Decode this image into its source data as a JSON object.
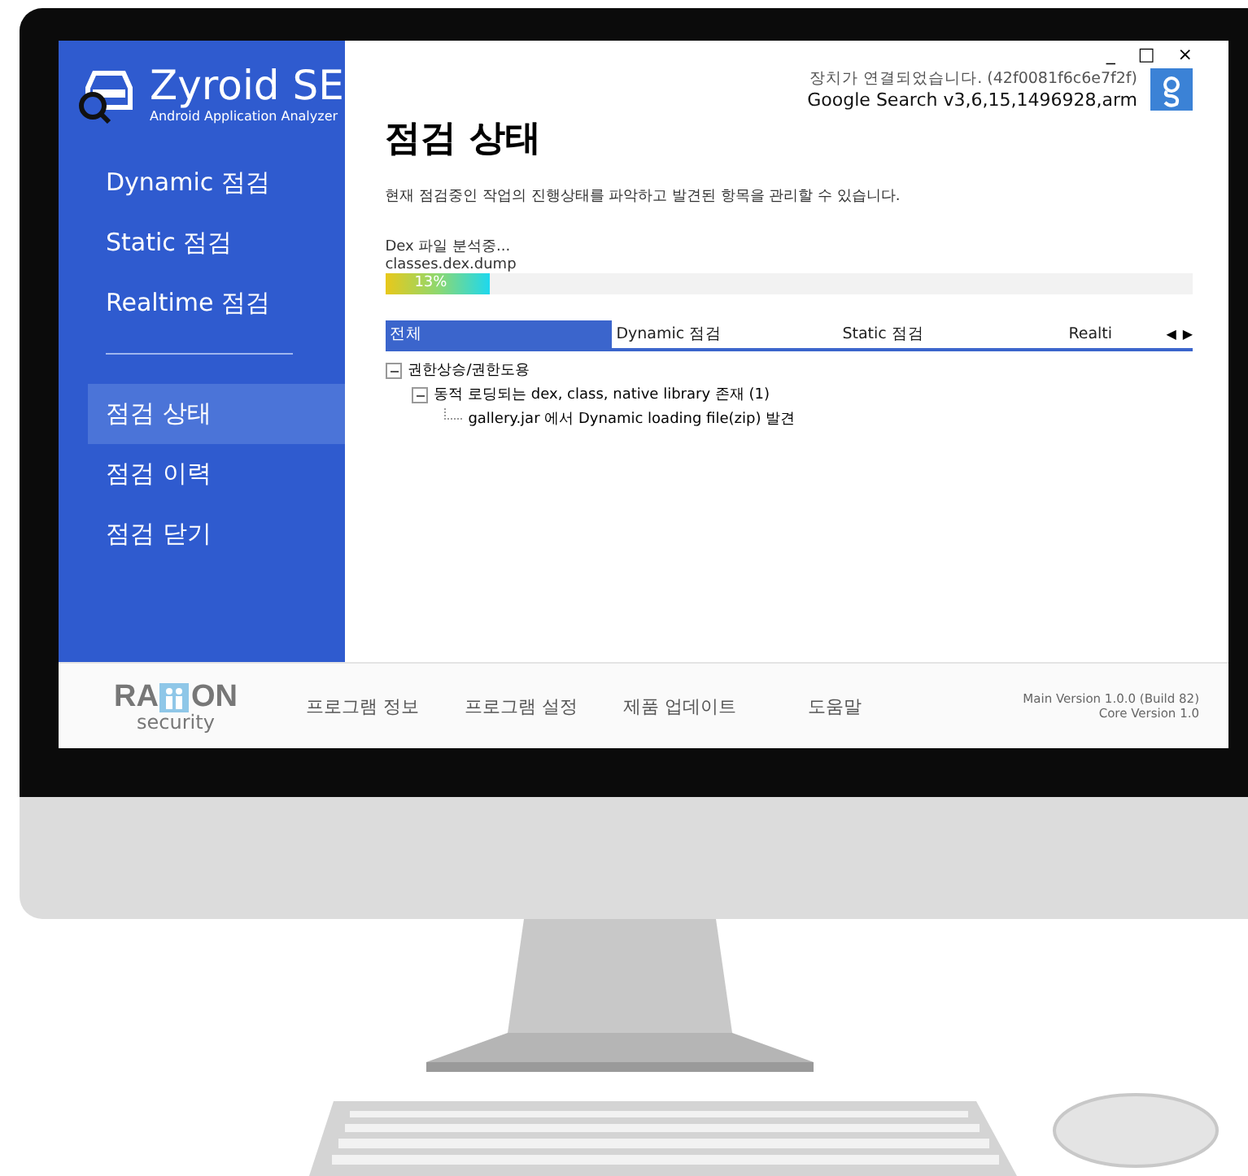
{
  "app": {
    "name": "Zyroid SE",
    "subtitle": "Android Application Analyzer"
  },
  "sidebar": {
    "items": [
      {
        "label": "Dynamic 점검",
        "selected": false
      },
      {
        "label": "Static 점검",
        "selected": false
      },
      {
        "label": "Realtime 점검",
        "selected": false
      }
    ],
    "items_2": [
      {
        "label": "점검 상태",
        "selected": true
      },
      {
        "label": "점검 이력",
        "selected": false
      },
      {
        "label": "점검 닫기",
        "selected": false
      }
    ]
  },
  "window_controls": [
    "_",
    "□",
    "×"
  ],
  "device": {
    "status": "장치가 연결되었습니다. (42f0081f6c6e7f2f)",
    "app": "Google Search v3,6,15,1496928,arm"
  },
  "page": {
    "title": "점검 상태",
    "description": "현재 점검중인 작업의 진행상태를 파악하고 발견된 항목을 관리할 수 있습니다."
  },
  "progress": {
    "task": "Dex 파일 분석중...",
    "file": "classes.dex.dump",
    "level": 0.13,
    "reading": "13%"
  },
  "tabs": [
    {
      "label": "전체",
      "selected": true
    },
    {
      "label": "Dynamic 점검",
      "selected": false
    },
    {
      "label": "Static 점검",
      "selected": false
    },
    {
      "label": "Realti",
      "selected": false
    }
  ],
  "tab_scroll": [
    "◀",
    "▶"
  ],
  "tree": [
    {
      "label": "권한상승/권한도용",
      "expanded": true,
      "children": [
        {
          "label": "동적 로딩되는 dex, class, native library 존재 (1)",
          "expanded": true,
          "children": [
            {
              "label": "gallery.jar 에서 Dynamic loading file(zip) 발견"
            }
          ]
        }
      ]
    }
  ],
  "footer": {
    "logo": {
      "left": "RA",
      "right": "ON",
      "sub": "security"
    },
    "links": [
      "프로그램 정보",
      "프로그램 설정",
      "제품 업데이트",
      "도움말"
    ],
    "versions": [
      "Main Version 1.0.0 (Build 82)",
      "Core Version 1.0"
    ]
  }
}
